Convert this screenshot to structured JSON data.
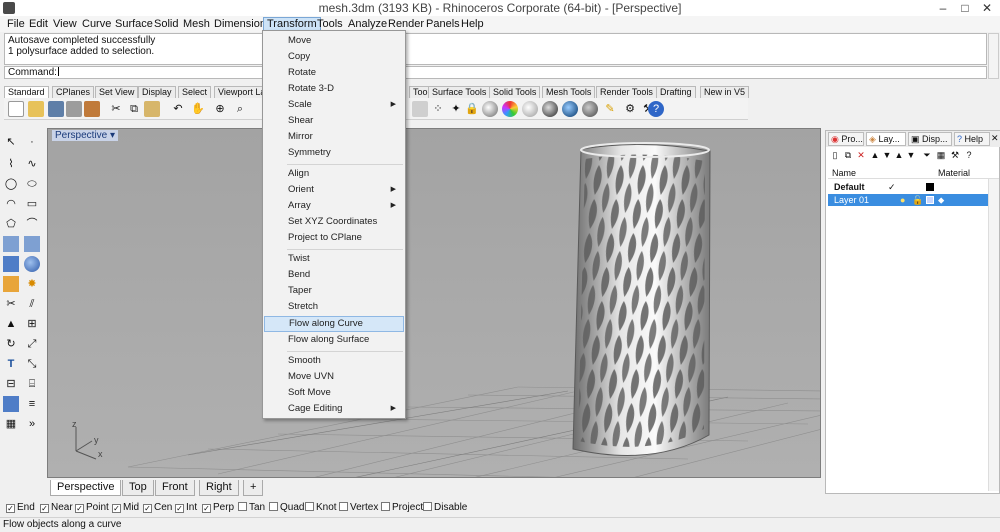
{
  "window": {
    "title": "mesh.3dm (3193 KB) - Rhinoceros Corporate (64-bit) - [Perspective]",
    "minimize": "–",
    "maximize": "□",
    "close": "✕"
  },
  "menubar": [
    "File",
    "Edit",
    "View",
    "Curve",
    "Surface",
    "Solid",
    "Mesh",
    "Dimension",
    "Transform",
    "Tools",
    "Analyze",
    "Render",
    "Panels",
    "Help"
  ],
  "history": {
    "line1": "Autosave completed successfully",
    "line2": "1 polysurface added to selection."
  },
  "command": {
    "label": "Command:"
  },
  "toolbar_tabs": [
    "Standard",
    "CPlanes",
    "Set View",
    "Display",
    "Select",
    "Viewport La",
    "Tools",
    "Surface Tools",
    "Solid Tools",
    "Mesh Tools",
    "Render Tools",
    "Drafting",
    "New in V5"
  ],
  "transform_menu": {
    "items": [
      {
        "label": "Move",
        "submenu": false
      },
      {
        "label": "Copy",
        "submenu": false
      },
      {
        "label": "Rotate",
        "submenu": false
      },
      {
        "label": "Rotate 3-D",
        "submenu": false
      },
      {
        "label": "Scale",
        "submenu": true
      },
      {
        "label": "Shear",
        "submenu": false
      },
      {
        "label": "Mirror",
        "submenu": false
      },
      {
        "label": "Symmetry",
        "submenu": false
      },
      {
        "label": "Align",
        "submenu": false
      },
      {
        "label": "Orient",
        "submenu": true
      },
      {
        "label": "Array",
        "submenu": true
      },
      {
        "label": "Set XYZ Coordinates",
        "submenu": false
      },
      {
        "label": "Project to CPlane",
        "submenu": false
      },
      {
        "label": "Twist",
        "submenu": false
      },
      {
        "label": "Bend",
        "submenu": false
      },
      {
        "label": "Taper",
        "submenu": false
      },
      {
        "label": "Stretch",
        "submenu": false
      },
      {
        "label": "Flow along Curve",
        "submenu": false,
        "highlighted": true
      },
      {
        "label": "Flow along Surface",
        "submenu": false
      },
      {
        "label": "Smooth",
        "submenu": false
      },
      {
        "label": "Move UVN",
        "submenu": false
      },
      {
        "label": "Soft Move",
        "submenu": false
      },
      {
        "label": "Cage Editing",
        "submenu": true
      }
    ]
  },
  "viewport": {
    "label": "Perspective",
    "axis_x": "x",
    "axis_y": "y",
    "axis_z": "z"
  },
  "viewport_tabs": [
    "Perspective",
    "Top",
    "Front",
    "Right",
    "+"
  ],
  "osnaps": [
    {
      "label": "End",
      "checked": true
    },
    {
      "label": "Near",
      "checked": true
    },
    {
      "label": "Point",
      "checked": true
    },
    {
      "label": "Mid",
      "checked": true
    },
    {
      "label": "Cen",
      "checked": true
    },
    {
      "label": "Int",
      "checked": true
    },
    {
      "label": "Perp",
      "checked": true
    },
    {
      "label": "Tan",
      "checked": false
    },
    {
      "label": "Quad",
      "checked": false
    },
    {
      "label": "Knot",
      "checked": false
    },
    {
      "label": "Vertex",
      "checked": false
    },
    {
      "label": "Project",
      "checked": false
    },
    {
      "label": "Disable",
      "checked": false
    }
  ],
  "status": "Flow objects along a curve",
  "panel": {
    "tabs": [
      "Pro...",
      "Lay...",
      "Disp...",
      "Help"
    ],
    "col_name": "Name",
    "col_material": "Material",
    "layers": [
      {
        "name": "Default",
        "check": "✓",
        "selected": false
      },
      {
        "name": "Layer 01",
        "check": "",
        "selected": true
      }
    ]
  },
  "colors": {
    "accent": "#3a8de0",
    "menu_highlight": "#d5e7f8",
    "viewport_bg": "#a6a6a6"
  }
}
